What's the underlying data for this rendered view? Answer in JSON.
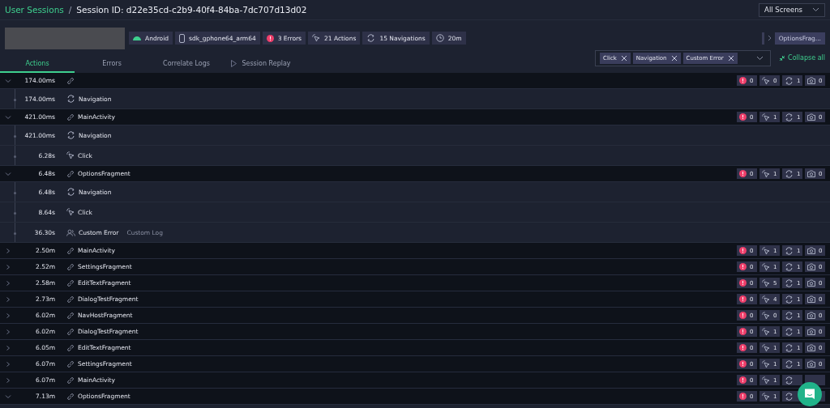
{
  "breadcrumb": {
    "link": "User Sessions",
    "separator": "/",
    "title": "Session ID: d22e35cd-c2b9-40f4-84ba-7dc707d13d02"
  },
  "screen_select": {
    "value": "All Screens"
  },
  "stats": [
    {
      "kind": "android",
      "label": "Android"
    },
    {
      "kind": "device",
      "label": "sdk_gphone64_arm64"
    },
    {
      "kind": "error",
      "label": "3 Errors"
    },
    {
      "kind": "click",
      "label": "21 Actions"
    },
    {
      "kind": "navigation",
      "label": "15 Navigations"
    },
    {
      "kind": "clock",
      "label": "20m"
    }
  ],
  "screen_path": {
    "label": "OptionsFrag..."
  },
  "tabs": [
    {
      "label": "Actions",
      "selected": true,
      "kind": "text"
    },
    {
      "label": "Errors",
      "selected": false,
      "kind": "text"
    },
    {
      "label": "Correlate Logs",
      "selected": false,
      "kind": "text"
    },
    {
      "label": "Session Replay",
      "selected": false,
      "kind": "play"
    }
  ],
  "filter": {
    "tags": [
      "Click",
      "Navigation",
      "Custom Error"
    ]
  },
  "collapse_all": {
    "label": "Collapse all"
  },
  "groups": [
    {
      "time": "174.00ms",
      "expanded": true,
      "counts": [
        {
          "kind": "error",
          "count": "0"
        },
        {
          "kind": "click",
          "count": "0"
        },
        {
          "kind": "navigation",
          "count": "1"
        },
        {
          "kind": "screenshot",
          "count": "0"
        }
      ],
      "children": [
        {
          "time": "174.00ms",
          "kind": "navigation",
          "label": "Navigation"
        }
      ]
    },
    {
      "time": "421.00ms",
      "screen": "MainActivity",
      "expanded": true,
      "counts": [
        {
          "kind": "error",
          "count": "0"
        },
        {
          "kind": "click",
          "count": "1"
        },
        {
          "kind": "navigation",
          "count": "1"
        },
        {
          "kind": "screenshot",
          "count": "0"
        }
      ],
      "children": [
        {
          "time": "421.00ms",
          "kind": "navigation",
          "label": "Navigation"
        },
        {
          "time": "6.28s",
          "kind": "click",
          "label": "Click"
        }
      ]
    },
    {
      "time": "6.48s",
      "screen": "OptionsFragment",
      "expanded": true,
      "counts": [
        {
          "kind": "error",
          "count": "0"
        },
        {
          "kind": "click",
          "count": "1"
        },
        {
          "kind": "navigation",
          "count": "1"
        },
        {
          "kind": "screenshot",
          "count": "0"
        }
      ],
      "children": [
        {
          "time": "6.48s",
          "kind": "navigation",
          "label": "Navigation"
        },
        {
          "time": "8.64s",
          "kind": "click",
          "label": "Click"
        },
        {
          "time": "36.30s",
          "kind": "custom_error",
          "label": "Custom Error",
          "note": "Custom Log"
        }
      ]
    },
    {
      "time": "2.50m",
      "screen": "MainActivity",
      "expanded": false,
      "counts": [
        {
          "kind": "error",
          "count": "0"
        },
        {
          "kind": "click",
          "count": "1"
        },
        {
          "kind": "navigation",
          "count": "1"
        },
        {
          "kind": "screenshot",
          "count": "0"
        }
      ]
    },
    {
      "time": "2.52m",
      "screen": "SettingsFragment",
      "expanded": false,
      "counts": [
        {
          "kind": "error",
          "count": "0"
        },
        {
          "kind": "click",
          "count": "1"
        },
        {
          "kind": "navigation",
          "count": "1"
        },
        {
          "kind": "screenshot",
          "count": "0"
        }
      ]
    },
    {
      "time": "2.58m",
      "screen": "EditTextFragment",
      "expanded": false,
      "counts": [
        {
          "kind": "error",
          "count": "0"
        },
        {
          "kind": "click",
          "count": "5"
        },
        {
          "kind": "navigation",
          "count": "1"
        },
        {
          "kind": "screenshot",
          "count": "0"
        }
      ]
    },
    {
      "time": "2.73m",
      "screen": "DialogTestFragment",
      "expanded": false,
      "counts": [
        {
          "kind": "error",
          "count": "0"
        },
        {
          "kind": "click",
          "count": "4"
        },
        {
          "kind": "navigation",
          "count": "1"
        },
        {
          "kind": "screenshot",
          "count": "0"
        }
      ]
    },
    {
      "time": "6.02m",
      "screen": "NavHostFragment",
      "expanded": false,
      "counts": [
        {
          "kind": "error",
          "count": "0"
        },
        {
          "kind": "click",
          "count": "0"
        },
        {
          "kind": "navigation",
          "count": "1"
        },
        {
          "kind": "screenshot",
          "count": "0"
        }
      ]
    },
    {
      "time": "6.02m",
      "screen": "DialogTestFragment",
      "expanded": false,
      "counts": [
        {
          "kind": "error",
          "count": "0"
        },
        {
          "kind": "click",
          "count": "1"
        },
        {
          "kind": "navigation",
          "count": "1"
        },
        {
          "kind": "screenshot",
          "count": "0"
        }
      ]
    },
    {
      "time": "6.05m",
      "screen": "EditTextFragment",
      "expanded": false,
      "counts": [
        {
          "kind": "error",
          "count": "0"
        },
        {
          "kind": "click",
          "count": "1"
        },
        {
          "kind": "navigation",
          "count": "1"
        },
        {
          "kind": "screenshot",
          "count": "0"
        }
      ]
    },
    {
      "time": "6.07m",
      "screen": "SettingsFragment",
      "expanded": false,
      "counts": [
        {
          "kind": "error",
          "count": "0"
        },
        {
          "kind": "click",
          "count": "1"
        },
        {
          "kind": "navigation",
          "count": "1"
        },
        {
          "kind": "screenshot",
          "count": "0"
        }
      ]
    },
    {
      "time": "6.07m",
      "screen": "MainActivity",
      "expanded": false,
      "counts": [
        {
          "kind": "error",
          "count": "0"
        },
        {
          "kind": "click",
          "count": "1"
        },
        {
          "kind": "navigation"
        },
        {
          "kind": "screenshot"
        }
      ]
    },
    {
      "time": "7.13m",
      "screen": "OptionsFragment",
      "expanded": true,
      "counts": [
        {
          "kind": "error",
          "count": "0"
        },
        {
          "kind": "click",
          "count": "1"
        },
        {
          "kind": "navigation"
        },
        {
          "kind": "screenshot"
        }
      ]
    }
  ]
}
